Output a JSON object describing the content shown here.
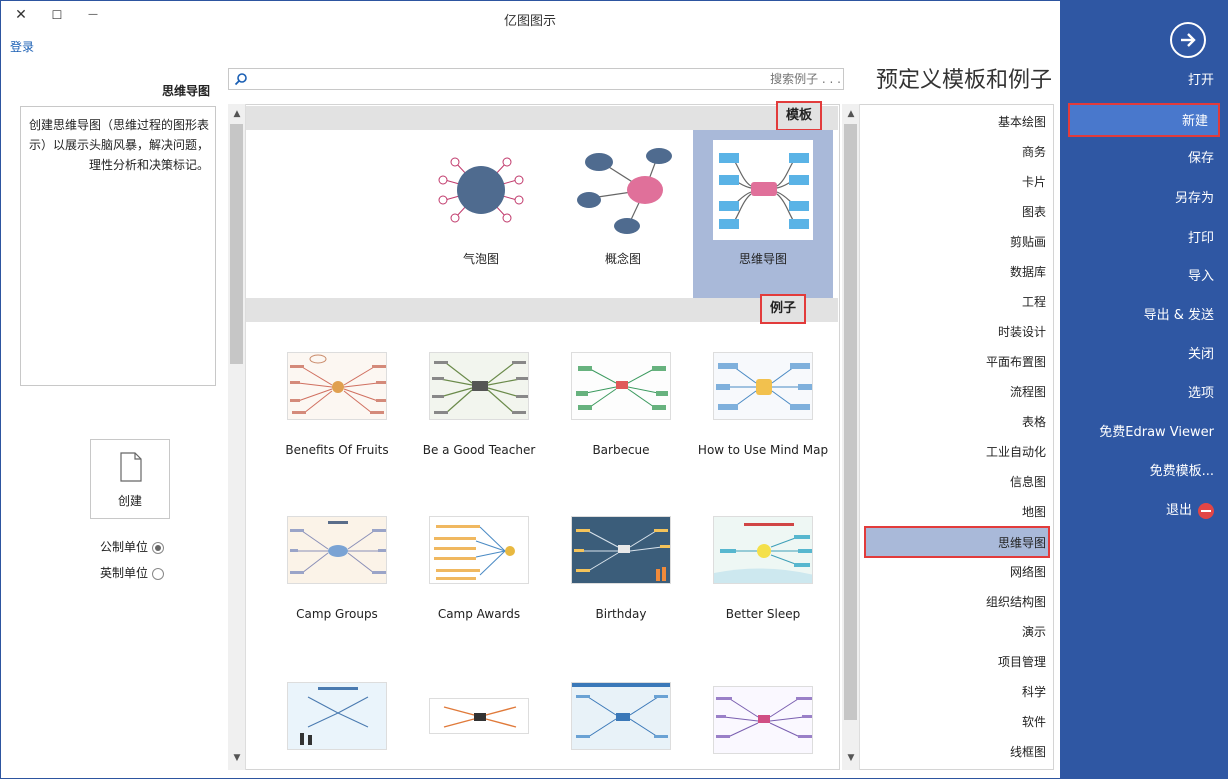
{
  "window": {
    "title": "亿图图示",
    "close_glyph": "✕",
    "maximize_glyph": "☐",
    "minimize_glyph": "—"
  },
  "login_link": "登录",
  "left": {
    "preview_title": "思维导图",
    "description": "创建思维导图（思维过程的图形表示）以展示头脑风暴，解决问题，理性分析和决策标记。",
    "create_label": "创建",
    "units": [
      {
        "label": "公制单位",
        "checked": true
      },
      {
        "label": "英制单位",
        "checked": false
      }
    ]
  },
  "search": {
    "placeholder": "搜索例子 . . ."
  },
  "gallery": {
    "templates_header": "模板",
    "examples_header": "例子",
    "templates": [
      {
        "label": "思维导图",
        "selected": true,
        "icon": "mind-map-template-icon"
      },
      {
        "label": "概念图",
        "selected": false,
        "icon": "concept-map-template-icon"
      },
      {
        "label": "气泡图",
        "selected": false,
        "icon": "bubble-chart-template-icon"
      }
    ],
    "examples": [
      {
        "label": "How to Use Mind Map"
      },
      {
        "label": "Barbecue"
      },
      {
        "label": "Be a Good Teacher"
      },
      {
        "label": "Benefits Of Fruits"
      },
      {
        "label": "Better Sleep"
      },
      {
        "label": "Birthday"
      },
      {
        "label": "Camp Awards"
      },
      {
        "label": "Camp Groups"
      },
      {
        "label": ""
      },
      {
        "label": ""
      },
      {
        "label": ""
      },
      {
        "label": ""
      }
    ]
  },
  "categories": {
    "panel_title": "预定义模板和例子",
    "items": [
      "基本绘图",
      "商务",
      "卡片",
      "图表",
      "剪贴画",
      "数据库",
      "工程",
      "时装设计",
      "平面布置图",
      "流程图",
      "表格",
      "工业自动化",
      "信息图",
      "地图",
      "思维导图",
      "网络图",
      "组织结构图",
      "演示",
      "项目管理",
      "科学",
      "软件",
      "线框图"
    ],
    "active": "思维导图"
  },
  "menu": {
    "items": [
      "打开",
      "新建",
      "保存",
      "另存为",
      "打印",
      "导入",
      "导出 & 发送",
      "关闭",
      "选项",
      "免费Edraw Viewer",
      "免费模板...",
      "退出"
    ],
    "active": "新建"
  },
  "colors": {
    "menu_bg": "#2f57a3",
    "menu_active": "#4978cc",
    "highlight_border": "#e23b3b",
    "selection_bg": "#a9b9d9",
    "link": "#1a5fb4"
  }
}
